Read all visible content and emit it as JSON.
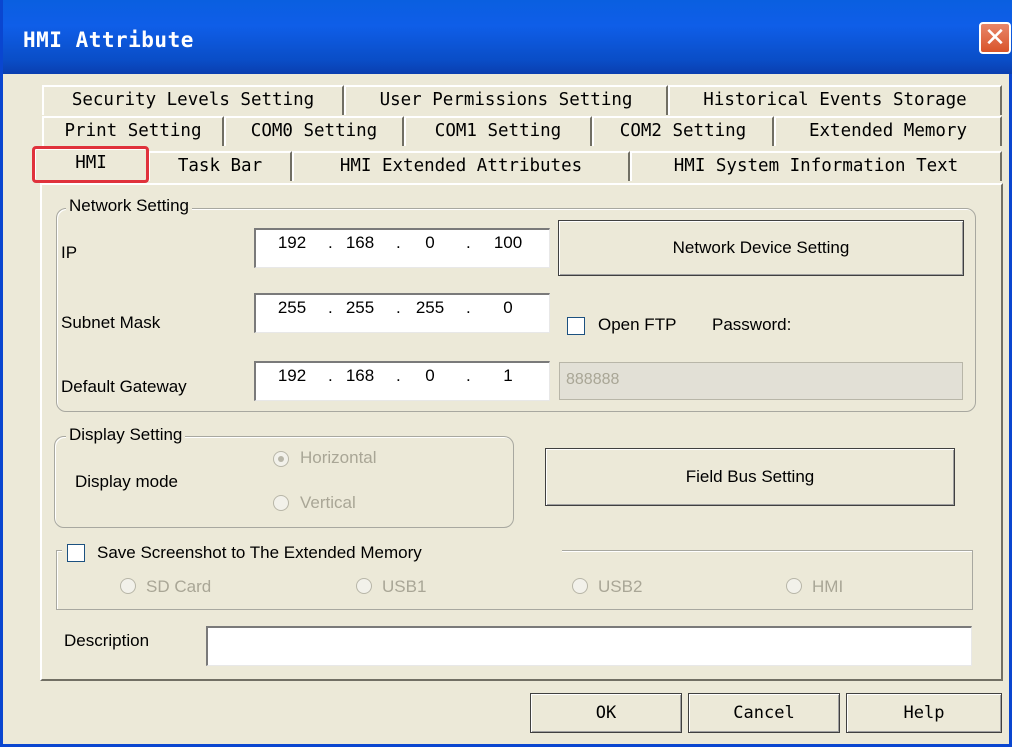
{
  "window": {
    "title": "HMI Attribute",
    "close_icon": "close-icon"
  },
  "tabs": {
    "row1": [
      "Security Levels Setting",
      "User Permissions Setting",
      "Historical Events Storage"
    ],
    "row2": [
      "Print Setting",
      "COM0 Setting",
      "COM1 Setting",
      "COM2 Setting",
      "Extended Memory"
    ],
    "row3": [
      "HMI",
      "Task Bar",
      "HMI Extended Attributes",
      "HMI System Information Text"
    ],
    "active": "HMI"
  },
  "network": {
    "legend": "Network Setting",
    "ip_label": "IP",
    "ip": [
      "192",
      "168",
      "0",
      "100"
    ],
    "subnet_label": "Subnet Mask",
    "subnet": [
      "255",
      "255",
      "255",
      "0"
    ],
    "gateway_label": "Default Gateway",
    "gateway": [
      "192",
      "168",
      "0",
      "1"
    ],
    "device_button": "Network Device Setting",
    "ftp_label": "Open FTP",
    "ftp_checked": false,
    "password_label": "Password:",
    "password_value": "888888"
  },
  "display": {
    "legend": "Display Setting",
    "mode_label": "Display mode",
    "options": [
      "Horizontal",
      "Vertical"
    ],
    "selected": "Horizontal"
  },
  "fieldbus_button": "Field Bus Setting",
  "screenshot": {
    "label": "Save Screenshot to The Extended Memory",
    "checked": false,
    "options": [
      "SD Card",
      "USB1",
      "USB2",
      "HMI"
    ]
  },
  "description": {
    "label": "Description",
    "value": ""
  },
  "buttons": {
    "ok": "OK",
    "cancel": "Cancel",
    "help": "Help"
  },
  "colors": {
    "titlebar": "#0a5fe0",
    "highlight": "#e0323c",
    "dialog_bg": "#ece9d8"
  }
}
